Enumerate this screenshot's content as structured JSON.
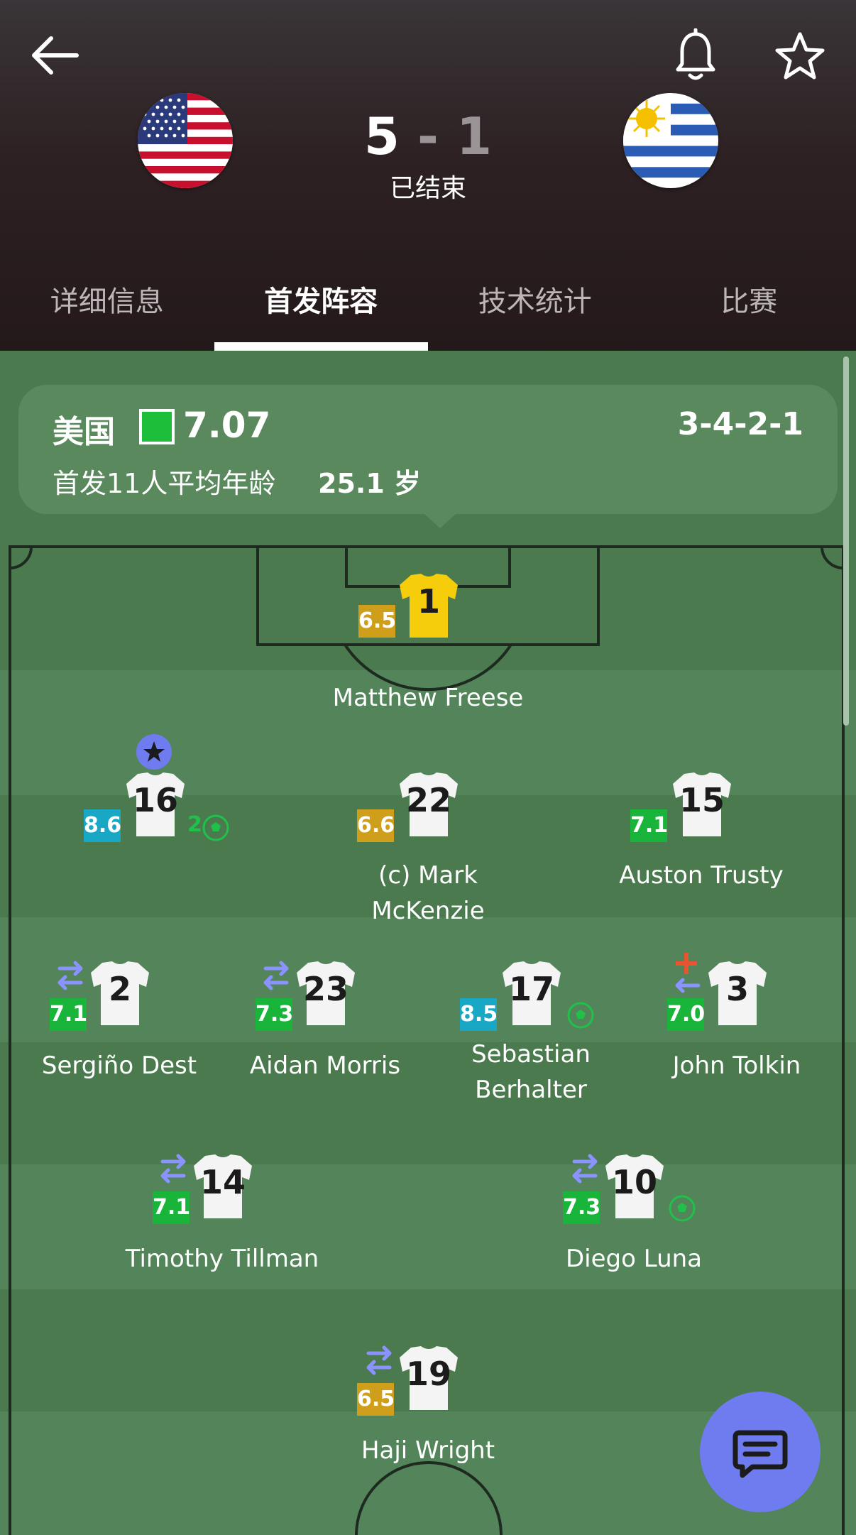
{
  "header": {
    "home_score": "5",
    "separator": "-",
    "away_score": "1",
    "status": "已结束",
    "home_flag": "usa-flag",
    "away_flag": "uruguay-flag"
  },
  "tabs": [
    {
      "label": "详细信息",
      "active": false
    },
    {
      "label": "首发阵容",
      "active": true
    },
    {
      "label": "技术统计",
      "active": false
    },
    {
      "label": "比赛",
      "active": false
    }
  ],
  "team_card": {
    "name": "美国",
    "rating": "7.07",
    "formation": "3-4-2-1",
    "avg_age_label": "首发11人平均年龄",
    "avg_age_value": "25.1 岁"
  },
  "players": [
    {
      "number": "1",
      "name": "Matthew Freese",
      "rating": "6.5",
      "rating_color": "yellow",
      "shirt": "yellow"
    },
    {
      "number": "16",
      "name": "",
      "rating": "8.6",
      "rating_color": "blue",
      "shirt": "white",
      "goals": "2",
      "motm": true
    },
    {
      "number": "22",
      "name": "(c) Mark McKenzie",
      "rating": "6.6",
      "rating_color": "yellow",
      "shirt": "white"
    },
    {
      "number": "15",
      "name": "Auston Trusty",
      "rating": "7.1",
      "rating_color": "green",
      "shirt": "white"
    },
    {
      "number": "2",
      "name": "Sergiño Dest",
      "rating": "7.1",
      "rating_color": "green",
      "shirt": "white",
      "subbed": true
    },
    {
      "number": "23",
      "name": "Aidan Morris",
      "rating": "7.3",
      "rating_color": "green",
      "shirt": "white",
      "subbed": true
    },
    {
      "number": "17",
      "name_line1": "Sebastian",
      "name_line2": "Berhalter",
      "rating": "8.5",
      "rating_color": "blue",
      "shirt": "white",
      "goal": true
    },
    {
      "number": "3",
      "name": "John Tolkin",
      "rating": "7.0",
      "rating_color": "green",
      "shirt": "white",
      "subbed": true,
      "injured": true
    },
    {
      "number": "14",
      "name": "Timothy Tillman",
      "rating": "7.1",
      "rating_color": "green",
      "shirt": "white",
      "subbed": true
    },
    {
      "number": "10",
      "name": "Diego Luna",
      "rating": "7.3",
      "rating_color": "green",
      "shirt": "white",
      "subbed": true,
      "goal": true
    },
    {
      "number": "19",
      "name": "Haji Wright",
      "rating": "6.5",
      "rating_color": "yellow",
      "shirt": "white",
      "subbed": true
    }
  ],
  "colors": {
    "pitch_dark": "#4b7a4f",
    "pitch_light": "#53845a",
    "rating_yellow": "#cf9e1a",
    "rating_green": "#19b43a",
    "rating_blue": "#19a7c6",
    "sub_icon": "#8a93ff",
    "injury_icon": "#e8542f",
    "goal_icon": "#1fc14a",
    "fab": "#6f7cf0"
  },
  "icons": {
    "back": "arrow-left-icon",
    "bell": "bell-icon",
    "star": "star-outline-icon",
    "chat": "chat-icon"
  }
}
